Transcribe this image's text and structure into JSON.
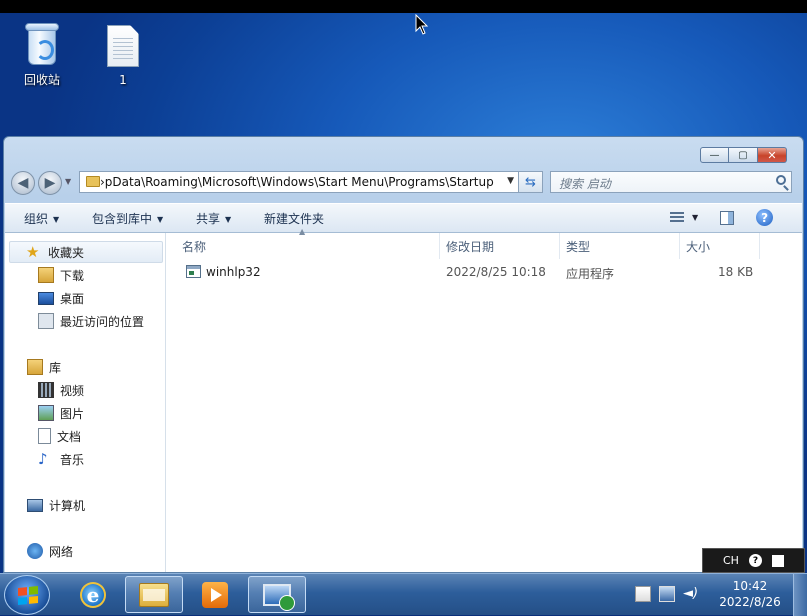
{
  "desktop": {
    "icons": [
      {
        "label": "回收站",
        "icon": "recycle-bin-icon"
      },
      {
        "label": "1",
        "icon": "text-file-icon"
      }
    ]
  },
  "explorer": {
    "caption_buttons": {
      "minimize": "—",
      "maximize": "▢",
      "close": "✕"
    },
    "address_path": "›pDatа\\Roaming\\Microsoft\\Windows\\Start Menu\\Programs\\Startup",
    "search_placeholder": "搜索 启动",
    "commands": {
      "organize": "组织",
      "include_in_library": "包含到库中",
      "share": "共享",
      "new_folder": "新建文件夹"
    },
    "nav": {
      "favorites": "收藏夹",
      "downloads": "下载",
      "desktop": "桌面",
      "recent_places": "最近访问的位置",
      "libraries": "库",
      "videos": "视频",
      "pictures": "图片",
      "documents": "文档",
      "music": "音乐",
      "computer": "计算机",
      "network": "网络"
    },
    "columns": {
      "name": "名称",
      "modified": "修改日期",
      "type": "类型",
      "size": "大小"
    },
    "files": [
      {
        "name": "winhlp32",
        "modified": "2022/8/25 10:18",
        "type": "应用程序",
        "size": "18 KB"
      }
    ]
  },
  "language_bar": {
    "lang": "CH"
  },
  "taskbar": {
    "pinned": [
      "ie-icon",
      "explorer-folder-icon",
      "media-player-icon",
      "remote-desktop-icon"
    ],
    "clock_time": "10:42",
    "clock_date": "2022/8/26"
  }
}
